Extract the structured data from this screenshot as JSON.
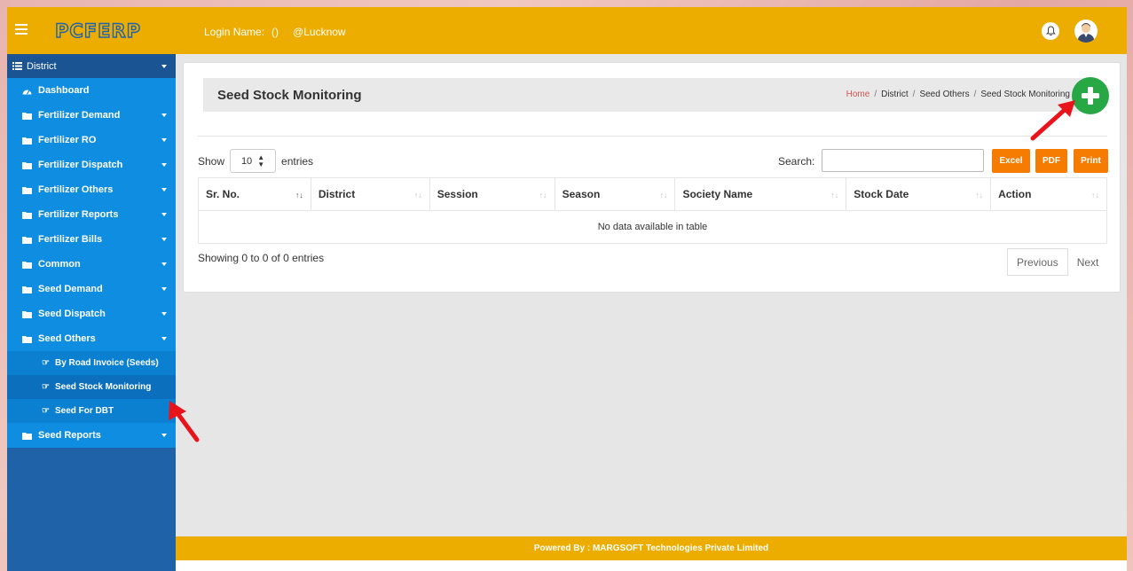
{
  "app": {
    "logo_text": "PCFERP"
  },
  "header": {
    "login_label": "Login Name:",
    "user_value": "()",
    "location": "@Lucknow",
    "bell_icon": "bell-icon",
    "avatar_icon": "user-avatar"
  },
  "sidebar": {
    "section_label": "District",
    "items": [
      {
        "label": "Dashboard",
        "icon": "dashboard-icon"
      },
      {
        "label": "Fertilizer Demand",
        "icon": "folder-icon"
      },
      {
        "label": "Fertilizer RO",
        "icon": "folder-icon"
      },
      {
        "label": "Fertilizer Dispatch",
        "icon": "folder-icon"
      },
      {
        "label": "Fertilizer Others",
        "icon": "folder-icon"
      },
      {
        "label": "Fertilizer Reports",
        "icon": "folder-icon"
      },
      {
        "label": "Fertilizer Bills",
        "icon": "folder-icon"
      },
      {
        "label": "Common",
        "icon": "folder-icon"
      },
      {
        "label": "Seed Demand",
        "icon": "folder-icon"
      },
      {
        "label": "Seed Dispatch",
        "icon": "folder-icon"
      },
      {
        "label": "Seed Others",
        "icon": "folder-icon"
      }
    ],
    "sub_items": [
      {
        "label": "By Road Invoice (Seeds)"
      },
      {
        "label": "Seed Stock Monitoring"
      },
      {
        "label": "Seed For DBT"
      }
    ],
    "last_item": {
      "label": "Seed Reports",
      "icon": "folder-icon"
    }
  },
  "main": {
    "page_title": "Seed Stock Monitoring",
    "breadcrumb": [
      "Home",
      "District",
      "Seed Others",
      "Seed Stock Monitoring"
    ],
    "show_label": "Show",
    "length_value": "10",
    "entries_label": "entries",
    "search_label": "Search:",
    "search_value": "",
    "buttons": {
      "excel": "Excel",
      "pdf": "PDF",
      "print": "Print"
    },
    "columns": [
      "Sr. No.",
      "District",
      "Session",
      "Season",
      "Society Name",
      "Stock Date",
      "Action"
    ],
    "empty_message": "No data available in table",
    "info_text": "Showing 0 to 0 of 0 entries",
    "pager": {
      "previous": "Previous",
      "next": "Next"
    }
  },
  "footer": {
    "text": "Powered By : MARGSOFT Technologies Private Limited"
  },
  "colors": {
    "header": "#ecad00",
    "sidebar": "#1f62a7",
    "sidebar_item": "#0f8de1",
    "add_button": "#28a745",
    "export_buttons": "#f57c00",
    "breadcrumb_home": "#d9534f",
    "annotation_arrow": "#e8141c"
  }
}
